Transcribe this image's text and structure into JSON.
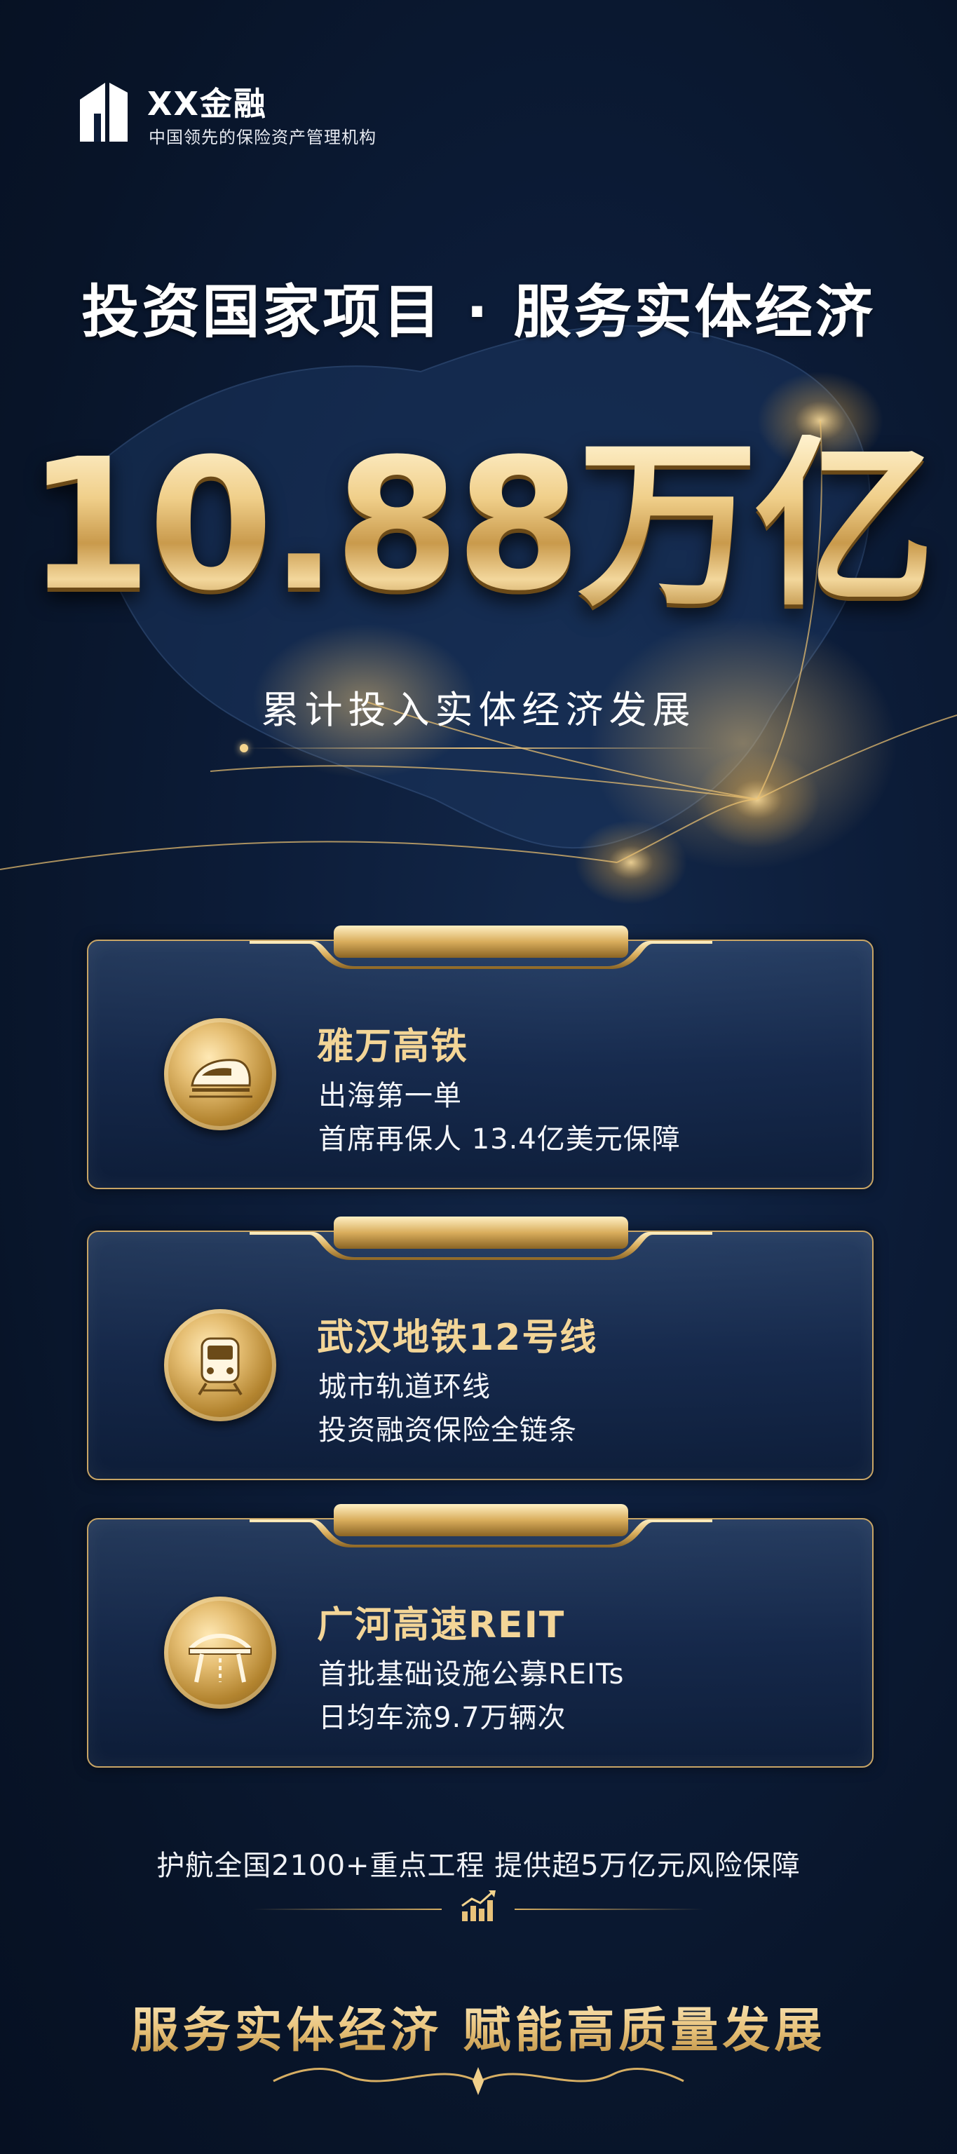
{
  "brand": {
    "name": "XX金融",
    "tagline": "中国领先的保险资产管理机构"
  },
  "hero": {
    "title": "投资国家项目 · 服务实体经济",
    "big_number": "10.88万亿",
    "subtitle": "累计投入实体经济发展"
  },
  "cards": [
    {
      "icon": "high-speed-train-icon",
      "title": "雅万高铁",
      "line1": "出海第一单",
      "line2": "首席再保人 13.4亿美元保障"
    },
    {
      "icon": "metro-train-icon",
      "title": "武汉地铁12号线",
      "line1": "城市轨道环线",
      "line2": "投资融资保险全链条"
    },
    {
      "icon": "highway-bridge-icon",
      "title": "广河高速REIT",
      "line1": "首批基础设施公募REITs",
      "line2": "日均车流9.7万辆次"
    }
  ],
  "footer": {
    "stat": "护航全国2100+重点工程  提供超5万亿元风险保障",
    "chart_icon": "growth-chart-icon",
    "slogan": "服务实体经济  赋能高质量发展"
  },
  "colors": {
    "background": "#0c1c38",
    "gold": "#e8c27a",
    "gold_dark": "#b3842f",
    "card_border": "#c8a566"
  }
}
